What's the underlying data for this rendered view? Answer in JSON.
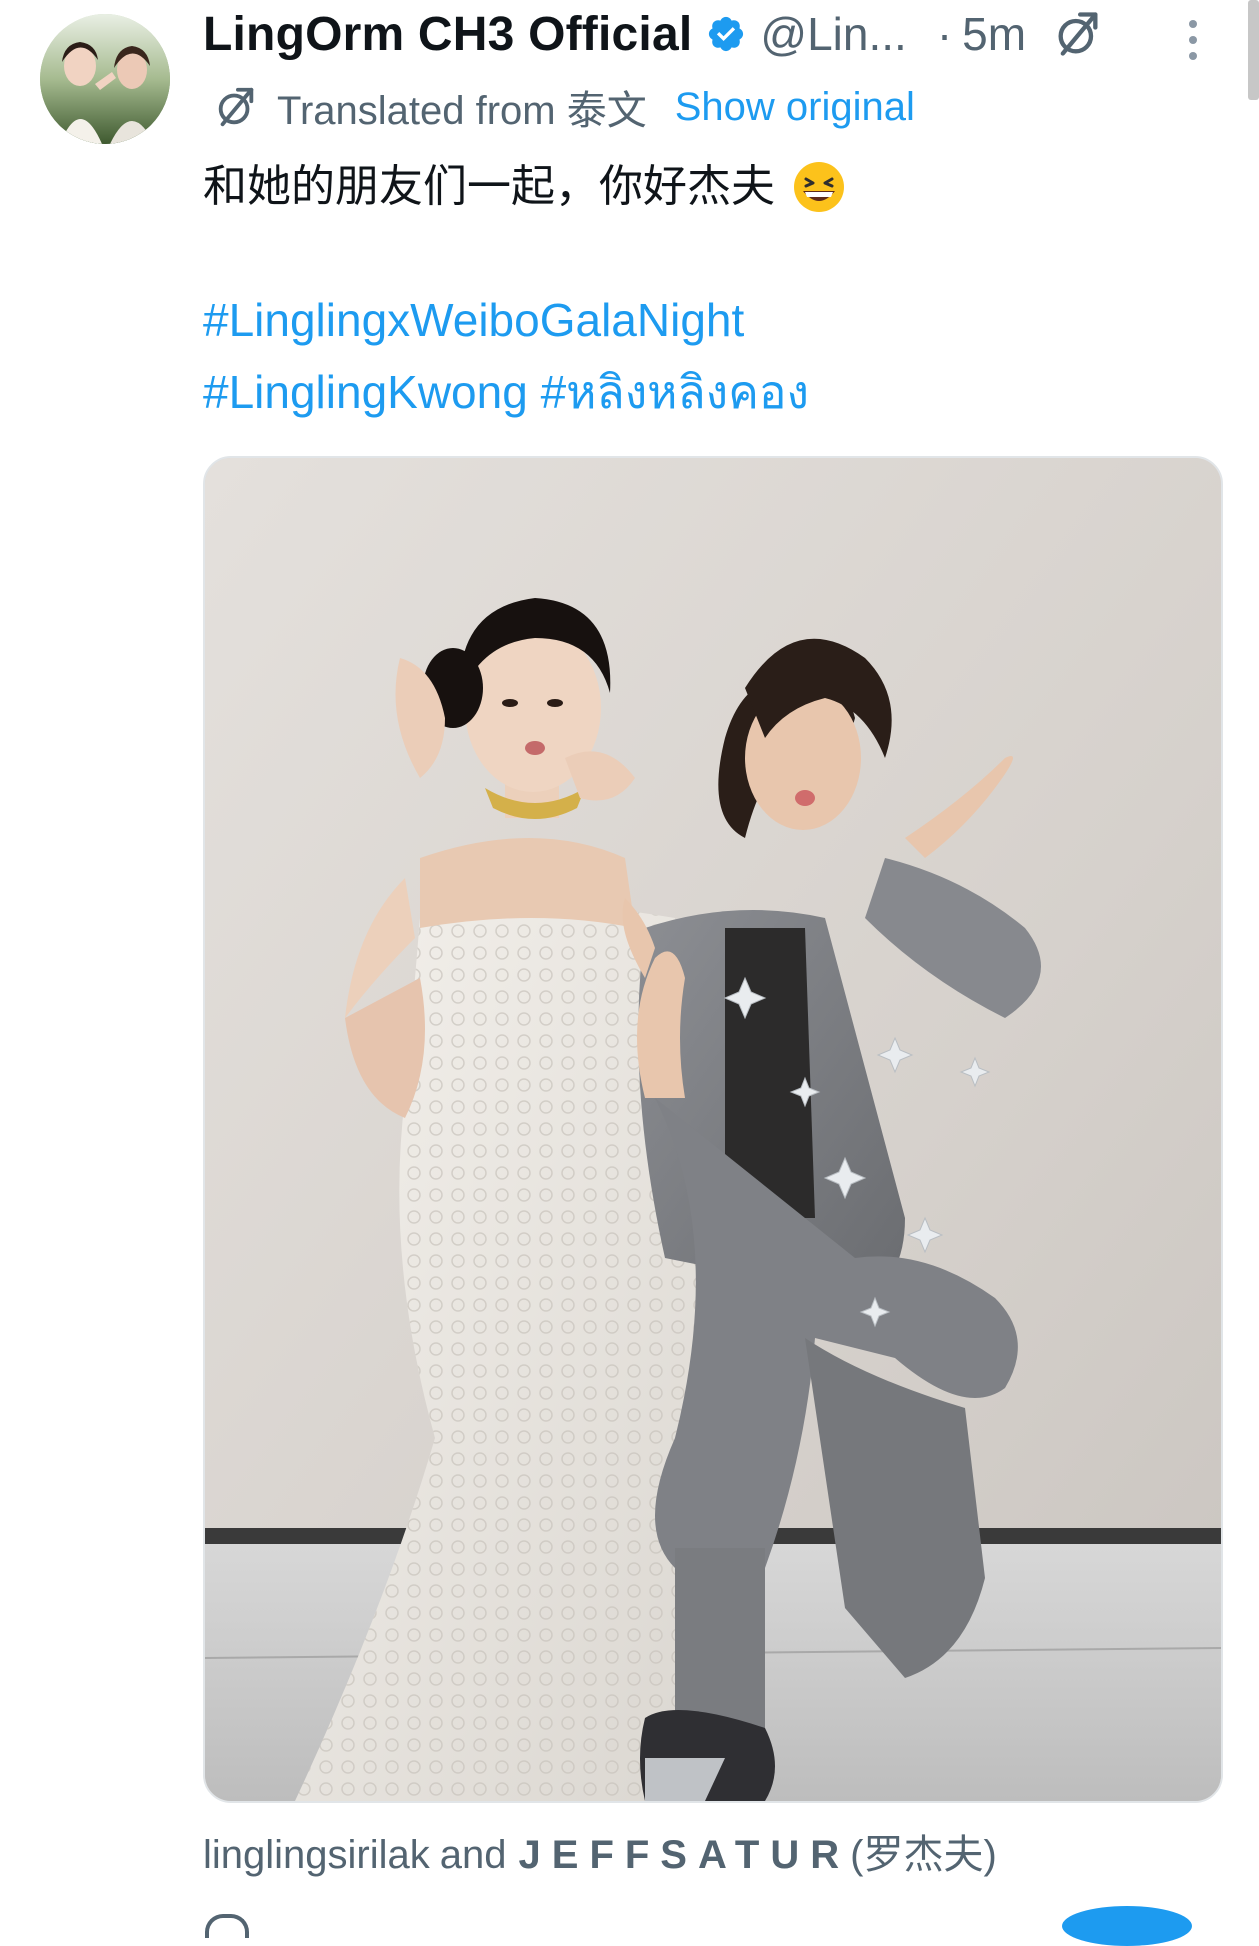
{
  "post": {
    "author": {
      "display_name": "LingOrm CH3 Official",
      "handle": "@Lin...",
      "verified": true,
      "avatar": "profile-photo"
    },
    "separator": "·",
    "time": "5m",
    "translation": {
      "label": "Translated from 泰文",
      "show_original": "Show original"
    },
    "text": "和她的朋友们一起，你好杰夫",
    "emoji": "grinning-squinting-face",
    "hashtags": [
      "#LinglingxWeiboGalaNight",
      "#LinglingKwong",
      "#หลิงหลิงคอง"
    ],
    "media_tags": {
      "tag1": "linglingsirilak",
      "joiner": "and",
      "tag2": "JEFFSATUR",
      "tag2_suffix": "(罗杰夫)"
    }
  },
  "colors": {
    "link": "#1d9bf0",
    "secondary_text": "#536471",
    "primary_text": "#0f1419",
    "verified_badge": "#1d9bf0"
  },
  "icons": {
    "verified": "verified-badge-icon",
    "translate": "translate-icon",
    "more": "more-vertical-icon"
  }
}
